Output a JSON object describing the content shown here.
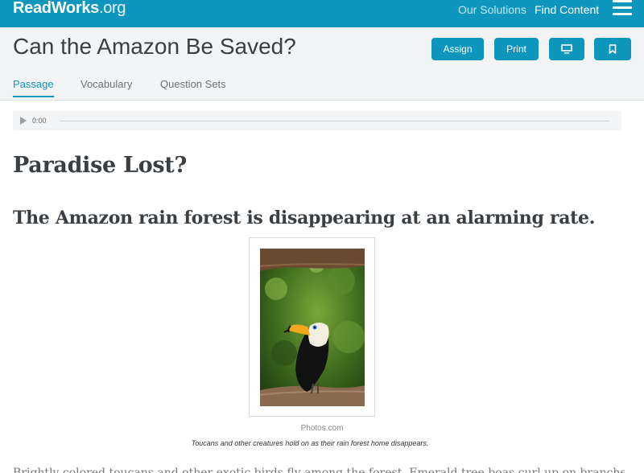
{
  "header": {
    "logo": "ReadWorks",
    "logo_suffix": ".org",
    "nav": {
      "solutions": "Our Solutions",
      "find_content": "Find Content"
    }
  },
  "title_bar": {
    "title": "Can the Amazon Be Saved?",
    "buttons": {
      "assign": "Assign",
      "print": "Print"
    },
    "tabs": [
      "Passage",
      "Vocabulary",
      "Question Sets"
    ]
  },
  "audio": {
    "time": "0:00"
  },
  "article": {
    "heading": "Paradise Lost?",
    "subheading": "The Amazon rain forest is disappearing at an alarming rate.",
    "figure": {
      "credit": "Photos.com",
      "caption": "Toucans and other creatures hold on as their rain forest home disappears."
    },
    "body_start": "Brightly colored toucans and other exotic birds fly among the forest. Emerald tree boas curl up on branches to"
  },
  "colors": {
    "brand": "#0f96bd",
    "title_bar_bg": "#f2f4f5"
  }
}
